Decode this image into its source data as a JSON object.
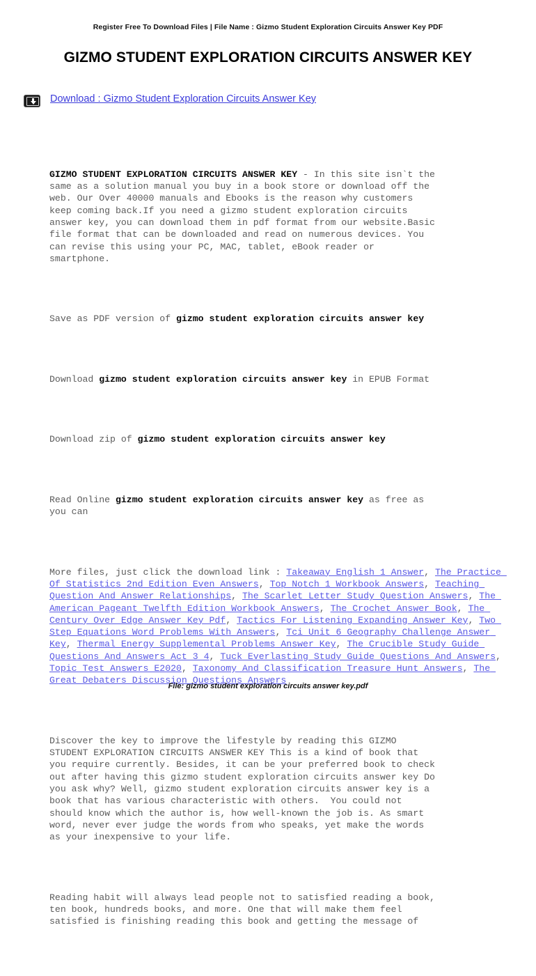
{
  "header": {
    "text": "Register Free To Download Files | File Name : Gizmo Student Exploration Circuits Answer Key PDF"
  },
  "title": "GIZMO STUDENT EXPLORATION CIRCUITS ANSWER KEY",
  "download": {
    "icon": "download-icon",
    "link_label": "Download : Gizmo Student Exploration Circuits Answer Key",
    "link_color": "#3b3bdb"
  },
  "keyword": "gizmo student exploration circuits answer key",
  "keyword_caps": "GIZMO STUDENT EXPLORATION CIRCUITS ANSWER KEY",
  "intro": {
    "lead_bold": "GIZMO STUDENT EXPLORATION CIRCUITS ANSWER KEY",
    "rest": " - In this site isn`t the\nsame as a solution manual you buy in a book store or download off the\nweb. Our Over 40000 manuals and Ebooks is the reason why customers\nkeep coming back.If you need a gizmo student exploration circuits\nanswer key, you can download them in pdf format from our website.Basic\nfile format that can be downloaded and read on numerous devices. You\ncan revise this using your PC, MAC, tablet, eBook reader or\nsmartphone."
  },
  "formats": [
    {
      "prefix": "Save as PDF version of ",
      "bold": "gizmo student exploration circuits answer key",
      "suffix": ""
    },
    {
      "prefix": "Download ",
      "bold": "gizmo student exploration circuits answer key",
      "suffix": " in EPUB Format"
    },
    {
      "prefix": "Download zip of ",
      "bold": "gizmo student exploration circuits answer key",
      "suffix": ""
    },
    {
      "prefix": "Read Online ",
      "bold": "gizmo student exploration circuits answer key",
      "suffix": " as free as\nyou can"
    }
  ],
  "more_files": {
    "intro": "More files, just click the download link : ",
    "links": [
      "Takeaway English 1 Answer",
      "The Practice Of Statistics 2nd Edition Even Answers",
      "Top Notch 1 Workbook Answers",
      "Teaching Question And Answer Relationships",
      "The Scarlet Letter Study Question Answers",
      "The American Pageant Twelfth Edition Workbook Answers",
      "The Crochet Answer Book",
      "The Century Over Edge Answer Key Pdf",
      "Tactics For Listening Expanding Answer Key",
      "Two Step Equations Word Problems With Answers",
      "Tci Unit 6 Geography Challenge Answer Key",
      "Thermal Energy Supplemental Problems Answer Key",
      "The Crucible Study Guide Questions And Answers Act 3 4",
      "Tuck Everlasting Study Guide Questions And Answers",
      "Topic Test Answers E2020",
      "Taxonomy And Classification Treasure Hunt Answers",
      "The Great Debaters Discussion Questions Answers"
    ],
    "separator": ", "
  },
  "discover_paragraph": "Discover the key to improve the lifestyle by reading this GIZMO\nSTUDENT EXPLORATION CIRCUITS ANSWER KEY This is a kind of book that\nyou require currently. Besides, it can be your preferred book to check\nout after having this gizmo student exploration circuits answer key Do\nyou ask why? Well, gizmo student exploration circuits answer key is a\nbook that has various characteristic with others.  You could not\nshould know which the author is, how well-known the job is. As smart\nword, never ever judge the words from who speaks, yet make the words\nas your inexpensive to your life.",
  "reading_paragraph": "Reading habit will always lead people not to satisfied reading a book,\nten book, hundreds books, and more. One that will make them feel\nsatisfied is finishing reading this book and getting the message of",
  "footer": {
    "text": "File: gizmo student exploration circuits answer key.pdf"
  }
}
